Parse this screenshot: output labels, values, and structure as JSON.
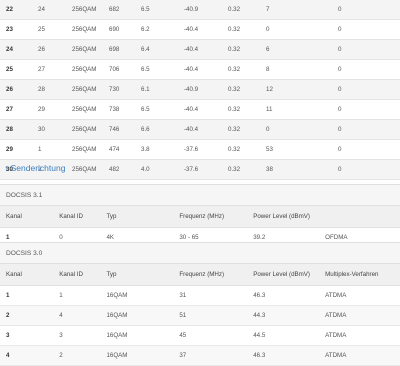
{
  "downstream": {
    "rows": [
      [
        "22",
        "24",
        "256QAM",
        "682",
        "6.5",
        "-40.9",
        "0.32",
        "7",
        "0"
      ],
      [
        "23",
        "25",
        "256QAM",
        "690",
        "6.2",
        "-40.4",
        "0.32",
        "0",
        "0"
      ],
      [
        "24",
        "26",
        "256QAM",
        "698",
        "6.4",
        "-40.4",
        "0.32",
        "6",
        "0"
      ],
      [
        "25",
        "27",
        "256QAM",
        "706",
        "6.5",
        "-40.4",
        "0.32",
        "8",
        "0"
      ],
      [
        "26",
        "28",
        "256QAM",
        "730",
        "6.1",
        "-40.9",
        "0.32",
        "12",
        "0"
      ],
      [
        "27",
        "29",
        "256QAM",
        "738",
        "6.5",
        "-40.4",
        "0.32",
        "11",
        "0"
      ],
      [
        "28",
        "30",
        "256QAM",
        "746",
        "6.6",
        "-40.4",
        "0.32",
        "0",
        "0"
      ],
      [
        "29",
        "1",
        "256QAM",
        "474",
        "3.8",
        "-37.6",
        "0.32",
        "53",
        "0"
      ],
      [
        "30",
        "2",
        "256QAM",
        "482",
        "4.0",
        "-37.6",
        "0.32",
        "38",
        "0"
      ]
    ]
  },
  "upstream_link": "↑ Senderichtung",
  "docsis31": {
    "title": "DOCSIS 3.1",
    "headers": [
      "Kanal",
      "Kanal ID",
      "Typ",
      "Frequenz (MHz)",
      "Power Level (dBmV)",
      ""
    ],
    "rows": [
      [
        "1",
        "0",
        "4K",
        "30 - 65",
        "39.2",
        "OFDMA"
      ]
    ]
  },
  "docsis30": {
    "title": "DOCSIS 3.0",
    "headers": [
      "Kanal",
      "Kanal ID",
      "Typ",
      "Frequenz (MHz)",
      "Power Level (dBmV)",
      "Multiplex-Verfahren"
    ],
    "rows": [
      [
        "1",
        "1",
        "16QAM",
        "31",
        "46.3",
        "ATDMA"
      ],
      [
        "2",
        "4",
        "16QAM",
        "51",
        "44.3",
        "ATDMA"
      ],
      [
        "3",
        "3",
        "16QAM",
        "45",
        "44.5",
        "ATDMA"
      ],
      [
        "4",
        "2",
        "16QAM",
        "37",
        "46.3",
        "ATDMA"
      ]
    ]
  }
}
